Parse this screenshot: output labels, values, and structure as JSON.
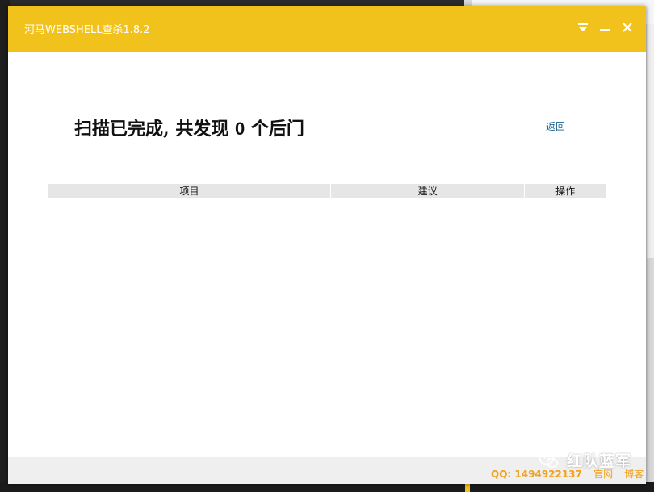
{
  "window": {
    "title": "河马WEBSHELL查杀1.8.2",
    "controls": {
      "menu_icon": "dropdown-triangle-icon",
      "minimize_icon": "minimize-icon",
      "close_icon": "close-icon"
    }
  },
  "result": {
    "headline_prefix": "扫描已完成, 共发现",
    "count": "0",
    "headline_suffix": "个后门",
    "back_label": "返回"
  },
  "table": {
    "headers": [
      "项目",
      "建议",
      "操作"
    ],
    "rows": []
  },
  "footer": {
    "qq": "QQ: 1494922137",
    "links": [
      "官网",
      "博客"
    ]
  },
  "watermark": {
    "text": "红队蓝军",
    "icon": "wechat-icon"
  },
  "colors": {
    "accent": "#f2c21c",
    "footer_text": "#f2a21c",
    "link": "#1a5f8c"
  }
}
